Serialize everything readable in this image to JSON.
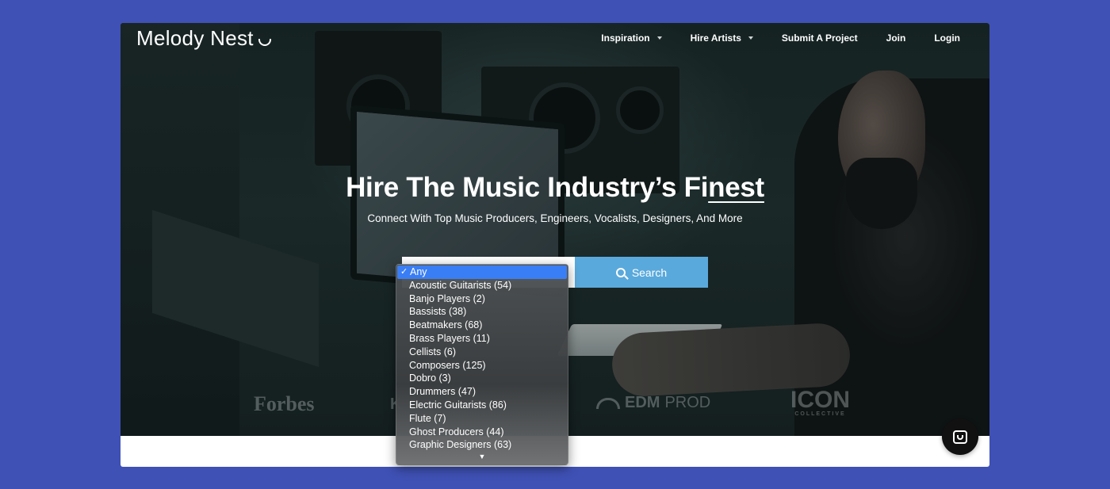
{
  "brand": {
    "name": "Melody Nest"
  },
  "nav": [
    {
      "label": "Inspiration",
      "has_dropdown": true
    },
    {
      "label": "Hire Artists",
      "has_dropdown": true
    },
    {
      "label": "Submit A Project",
      "has_dropdown": false
    },
    {
      "label": "Join",
      "has_dropdown": false
    },
    {
      "label": "Login",
      "has_dropdown": false
    }
  ],
  "hero": {
    "headline_main": "Hire The Music Industry’s Fi",
    "headline_underlined": "nest",
    "subheadline": "Connect With Top Music Producers, Engineers, Vocalists, Designers, And More"
  },
  "search": {
    "button_label": "Search",
    "selected_value": "Any"
  },
  "dropdown": {
    "options": [
      "Any",
      "Acoustic Guitarists (54)",
      "Banjo Players (2)",
      "Bassists (38)",
      "Beatmakers (68)",
      "Brass Players (11)",
      "Cellists (6)",
      "Composers (125)",
      "Dobro (3)",
      "Drummers (47)",
      "Electric Guitarists (86)",
      "Flute (7)",
      "Ghost Producers (44)",
      "Graphic Designers (63)"
    ],
    "selected_index": 0,
    "check_glyph": "✓",
    "more_glyph": "▼"
  },
  "press_logos": {
    "forbes": "Forbes",
    "partial": "K",
    "edm_bold": "EDM",
    "edm_light": "PROD",
    "icon": "ICON",
    "icon_sub": "COLLECTIVE"
  },
  "icons": {
    "search": "search-icon",
    "chat": "chat-icon",
    "caret": "caret-down-icon"
  },
  "colors": {
    "background": "#3f51b5",
    "search_button": "#5aa9dc",
    "dropdown_selected": "#3a7ef5"
  }
}
